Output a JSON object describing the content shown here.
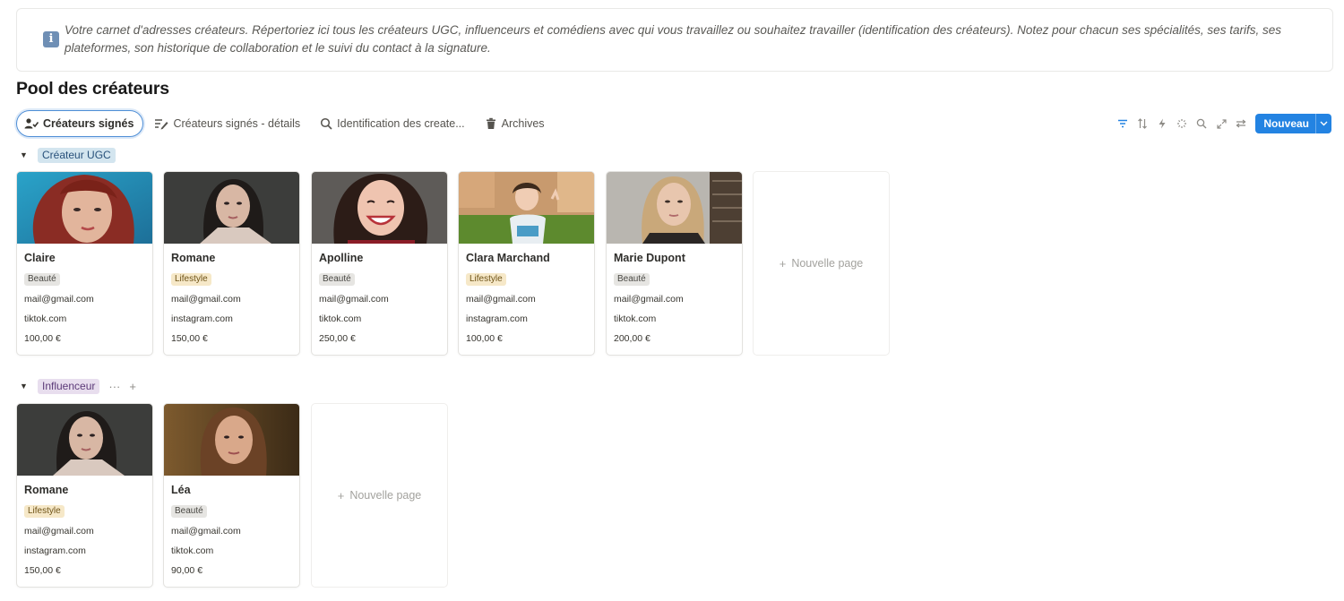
{
  "callout": {
    "icon": "info-icon",
    "text": "Votre carnet d'adresses créateurs. Répertoriez ici tous les créateurs UGC, influenceurs et comédiens avec qui vous travaillez ou souhaitez travailler (identification des créateurs). Notez pour chacun ses spécialités, ses tarifs, ses plateformes, son historique de collaboration et le suivi du contact à la signature."
  },
  "page_title": "Pool des créateurs",
  "tabs": [
    {
      "label": "Créateurs signés",
      "icon": "user-check-icon",
      "active": true
    },
    {
      "label": "Créateurs signés - détails",
      "icon": "list-edit-icon",
      "active": false
    },
    {
      "label": "Identification des create...",
      "icon": "search-icon",
      "active": false
    },
    {
      "label": "Archives",
      "icon": "trash-icon",
      "active": false
    }
  ],
  "toolbar": {
    "icons": [
      "filter-icon",
      "sort-icon",
      "automation-icon",
      "ai-sparkle-icon",
      "search-icon",
      "expand-icon",
      "settings-icon"
    ],
    "new_label": "Nouveau",
    "accent": "#2383e2"
  },
  "groups": [
    {
      "label": "Créateur UGC",
      "cards": [
        {
          "name": "Claire",
          "tag": "Beauté",
          "email": "mail@gmail.com",
          "platform": "tiktok.com",
          "price": "100,00 €"
        },
        {
          "name": "Romane",
          "tag": "Lifestyle",
          "email": "mail@gmail.com",
          "platform": "instagram.com",
          "price": "150,00 €"
        },
        {
          "name": "Apolline",
          "tag": "Beauté",
          "email": "mail@gmail.com",
          "platform": "tiktok.com",
          "price": "250,00 €"
        },
        {
          "name": "Clara Marchand",
          "tag": "Lifestyle",
          "email": "mail@gmail.com",
          "platform": "instagram.com",
          "price": "100,00 €"
        },
        {
          "name": "Marie Dupont",
          "tag": "Beauté",
          "email": "mail@gmail.com",
          "platform": "tiktok.com",
          "price": "200,00 €"
        }
      ],
      "new_page_label": "Nouvelle page"
    },
    {
      "label": "Influenceur",
      "more_label": "···",
      "add_label": "+",
      "cards": [
        {
          "name": "Romane",
          "tag": "Lifestyle",
          "email": "mail@gmail.com",
          "platform": "instagram.com",
          "price": "150,00 €"
        },
        {
          "name": "Léa",
          "tag": "Beauté",
          "email": "mail@gmail.com",
          "platform": "tiktok.com",
          "price": "90,00 €"
        }
      ],
      "new_page_label": "Nouvelle page"
    }
  ],
  "colors": {
    "tag_beaute": "#e6e5e2",
    "tag_lifestyle": "#f6e8c8",
    "group_ugc": "#d3e5ef",
    "group_influenceur": "#e8deee"
  }
}
